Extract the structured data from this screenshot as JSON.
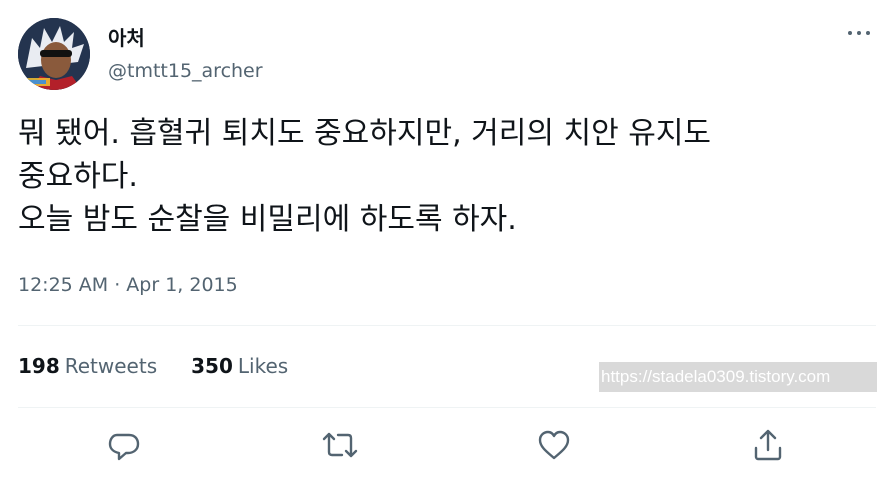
{
  "user": {
    "display_name": "아처",
    "handle": "@tmtt15_archer"
  },
  "tweet": {
    "text": "뭐 됐어. 흡혈귀 퇴치도 중요하지만, 거리의 치안 유지도\n중요하다.\n오늘 밤도 순찰을 비밀리에 하도록 하자.",
    "timestamp": "12:25 AM · Apr 1, 2015"
  },
  "stats": {
    "retweets_count": "198",
    "retweets_label": "Retweets",
    "likes_count": "350",
    "likes_label": "Likes"
  },
  "watermark": "https://stadela0309.tistory.com",
  "icons": [
    "more-icon",
    "reply-icon",
    "retweet-icon",
    "like-icon",
    "share-icon"
  ],
  "colors": {
    "text_primary": "#0f1419",
    "text_secondary": "#536471",
    "divider": "#eff3f4"
  }
}
